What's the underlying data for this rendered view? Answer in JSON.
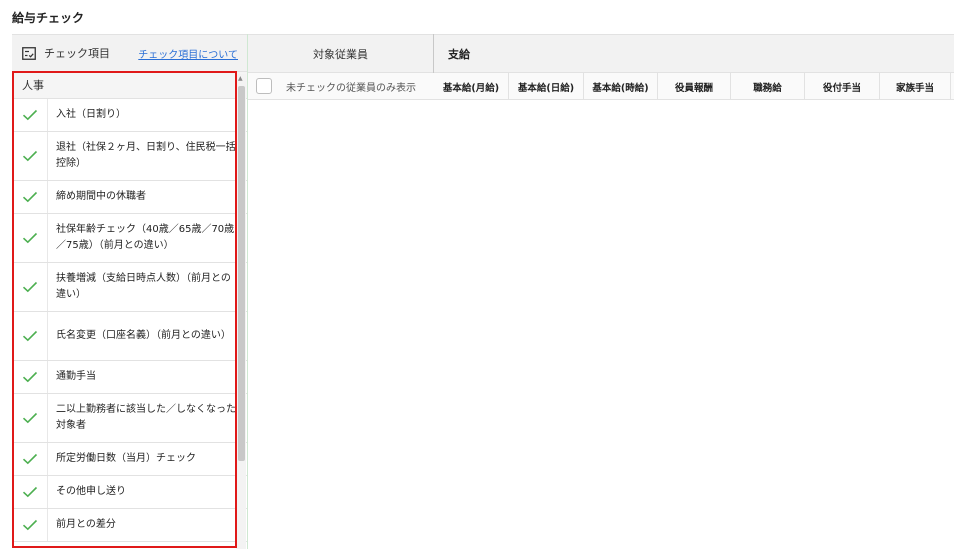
{
  "page": {
    "title": "給与チェック"
  },
  "left_panel": {
    "header_label": "チェック項目",
    "header_link": "チェック項目について",
    "section_title": "人事",
    "items": [
      {
        "label": "入社（日割り）"
      },
      {
        "label": "退社（社保２ヶ月、日割り、住民税一括控除）"
      },
      {
        "label": "締め期間中の休職者"
      },
      {
        "label": "社保年齢チェック（40歳／65歳／70歳／75歳）（前月との違い）"
      },
      {
        "label": "扶養増減（支給日時点人数）（前月との違い）"
      },
      {
        "label": "氏名変更（口座名義）（前月との違い）"
      },
      {
        "label": "通勤手当"
      },
      {
        "label": "二以上勤務者に該当した／しなくなった対象者"
      },
      {
        "label": "所定労働日数（当月）チェック"
      },
      {
        "label": "その他申し送り"
      },
      {
        "label": "前月との差分"
      }
    ]
  },
  "main": {
    "employee_column": "対象従業員",
    "filter_label": "未チェックの従業員のみ表示",
    "payment_section": "支給",
    "columns": [
      "基本給(月給)",
      "基本給(日給)",
      "基本給(時給)",
      "役員報酬",
      "職務給",
      "役付手当",
      "家族手当"
    ]
  },
  "colors": {
    "check": "#4caf50",
    "highlight": "#e01919",
    "link": "#2a6fd6"
  }
}
